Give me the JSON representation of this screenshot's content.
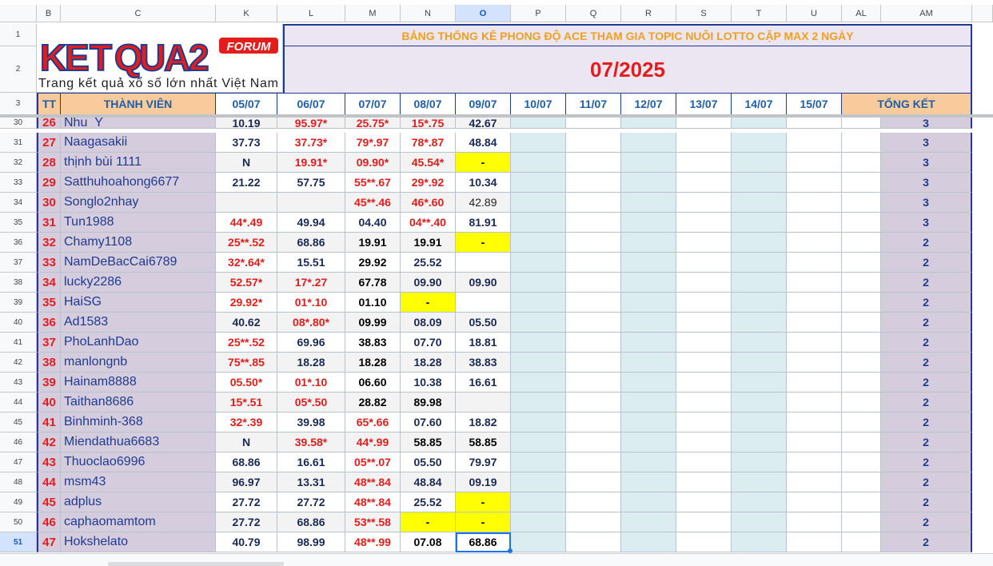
{
  "columns": [
    {
      "id": "B",
      "label": "B"
    },
    {
      "id": "C",
      "label": "C"
    },
    {
      "id": "K",
      "label": "K"
    },
    {
      "id": "L",
      "label": "L"
    },
    {
      "id": "M",
      "label": "M"
    },
    {
      "id": "N",
      "label": "N"
    },
    {
      "id": "O",
      "label": "O"
    },
    {
      "id": "P",
      "label": "P"
    },
    {
      "id": "Q",
      "label": "Q"
    },
    {
      "id": "R",
      "label": "R"
    },
    {
      "id": "S",
      "label": "S"
    },
    {
      "id": "T",
      "label": "T"
    },
    {
      "id": "U",
      "label": "U"
    },
    {
      "id": "AL",
      "label": "AL"
    },
    {
      "id": "AM",
      "label": "AM"
    }
  ],
  "logo": {
    "brand": "KETQUA2",
    "badge": "FORUM",
    "tagline": "Trang kết quả xổ số lớn nhất Việt Nam"
  },
  "title": "BẢNG THỐNG KÊ PHONG ĐỘ ACE THAM GIA TOPIC NUÔI LOTTO CẶP MAX 2 NGÀY",
  "month": "07/2025",
  "header": {
    "tt": "TT",
    "member": "THÀNH VIÊN",
    "dates": [
      "05/07",
      "06/07",
      "07/07",
      "08/07",
      "09/07",
      "10/07",
      "11/07",
      "12/07",
      "13/07",
      "14/07",
      "15/07"
    ],
    "total": "TỔNG KẾT"
  },
  "top_row_numbers": [
    "1",
    "2",
    "3"
  ],
  "rows": [
    {
      "row": "30",
      "tt": "26",
      "name": "Nhu_Y",
      "vals": [
        "10.19",
        "95.97*",
        "25.75*",
        "15*.75",
        "42.67"
      ],
      "total": "3"
    },
    {
      "row": "31",
      "tt": "27",
      "name": "Naagasakii",
      "vals": [
        "37.73",
        "37.73*",
        "79*.97",
        "78*.87",
        "48.84"
      ],
      "total": "3"
    },
    {
      "row": "32",
      "tt": "28",
      "name": "thịnh bùi 1111",
      "vals": [
        "N",
        "19.91*",
        "09.90*",
        "45.54*",
        "-"
      ],
      "total": "3"
    },
    {
      "row": "33",
      "tt": "29",
      "name": "Satthuhoahong6677",
      "vals": [
        "21.22",
        "57.75",
        "55**.67",
        "29*.92",
        "10.34"
      ],
      "total": "3"
    },
    {
      "row": "34",
      "tt": "30",
      "name": "Songlo2nhay",
      "vals": [
        "",
        "",
        "45**.46",
        "46*.60",
        "42.89"
      ],
      "total": "3"
    },
    {
      "row": "35",
      "tt": "31",
      "name": "Tun1988",
      "vals": [
        "44*.49",
        "49.94",
        "04.40",
        "04**.40",
        "81.91"
      ],
      "total": "3"
    },
    {
      "row": "36",
      "tt": "32",
      "name": "Chamy1108",
      "vals": [
        "25**.52",
        "68.86",
        "19.91",
        "19.91",
        "-"
      ],
      "total": "2"
    },
    {
      "row": "37",
      "tt": "33",
      "name": "NamDeBacCai6789",
      "vals": [
        "32*.64*",
        "15.51",
        "29.92",
        "25.52",
        ""
      ],
      "total": "2"
    },
    {
      "row": "38",
      "tt": "34",
      "name": "lucky2286",
      "vals": [
        "52.57*",
        "17*.27",
        "67.78",
        "09.90",
        "09.90"
      ],
      "total": "2"
    },
    {
      "row": "39",
      "tt": "35",
      "name": "HaiSG",
      "vals": [
        "29.92*",
        "01*.10",
        "01.10",
        "-",
        ""
      ],
      "total": "2"
    },
    {
      "row": "40",
      "tt": "36",
      "name": "Ad1583",
      "vals": [
        "40.62",
        "08*.80*",
        "09.99",
        "08.09",
        "05.50"
      ],
      "total": "2"
    },
    {
      "row": "41",
      "tt": "37",
      "name": "PhoLanhDao",
      "vals": [
        "25**.52",
        "69.96",
        "38.83",
        "07.70",
        "18.81"
      ],
      "total": "2"
    },
    {
      "row": "42",
      "tt": "38",
      "name": "manlongnb",
      "vals": [
        "75**.85",
        "18.28",
        "18.28",
        "18.28",
        "38.83"
      ],
      "total": "2"
    },
    {
      "row": "43",
      "tt": "39",
      "name": "Hainam8888",
      "vals": [
        "05.50*",
        "01*.10",
        "06.60",
        "10.38",
        "16.61"
      ],
      "total": "2"
    },
    {
      "row": "44",
      "tt": "40",
      "name": "Taithan8686",
      "vals": [
        "15*.51",
        "05*.50",
        "28.82",
        "89.98",
        ""
      ],
      "total": "2"
    },
    {
      "row": "45",
      "tt": "41",
      "name": "Binhminh-368",
      "vals": [
        "32*.39",
        "39.98",
        "65*.66",
        "07.60",
        "18.82"
      ],
      "total": "2"
    },
    {
      "row": "46",
      "tt": "42",
      "name": "Miendathua6683",
      "vals": [
        "N",
        "39.58*",
        "44*.99",
        "58.85",
        "58.85"
      ],
      "total": "2"
    },
    {
      "row": "47",
      "tt": "43",
      "name": "Thuoclao6996",
      "vals": [
        "68.86",
        "16.61",
        "05**.07",
        "05.50",
        "79.97"
      ],
      "total": "2"
    },
    {
      "row": "48",
      "tt": "44",
      "name": "msm43",
      "vals": [
        "96.97",
        "13.31",
        "48**.84",
        "48.84",
        "09.19"
      ],
      "total": "2"
    },
    {
      "row": "49",
      "tt": "45",
      "name": "adplus",
      "vals": [
        "27.72",
        "27.72",
        "48**.84",
        "25.52",
        "-"
      ],
      "total": "2"
    },
    {
      "row": "50",
      "tt": "46",
      "name": "caphaomamtom",
      "vals": [
        "27.72",
        "68.86",
        "53**.58",
        "-",
        "-"
      ],
      "total": "2"
    },
    {
      "row": "51",
      "tt": "47",
      "name": "Hokshelato",
      "vals": [
        "40.79",
        "98.99",
        "48**.99",
        "07.08",
        "68.86"
      ],
      "total": "2"
    }
  ],
  "styles": {
    "red_cells": [
      [
        0,
        1
      ],
      [
        0,
        2
      ],
      [
        0,
        3
      ],
      [
        1,
        1
      ],
      [
        1,
        2
      ],
      [
        1,
        3
      ],
      [
        2,
        1
      ],
      [
        2,
        2
      ],
      [
        2,
        3
      ],
      [
        3,
        2
      ],
      [
        3,
        3
      ],
      [
        4,
        2
      ],
      [
        4,
        3
      ],
      [
        5,
        0
      ],
      [
        5,
        3
      ],
      [
        6,
        0
      ],
      [
        7,
        0
      ],
      [
        8,
        0
      ],
      [
        8,
        1
      ],
      [
        9,
        0
      ],
      [
        9,
        1
      ],
      [
        10,
        1
      ],
      [
        11,
        0
      ],
      [
        12,
        0
      ],
      [
        13,
        0
      ],
      [
        13,
        1
      ],
      [
        14,
        0
      ],
      [
        14,
        1
      ],
      [
        15,
        0
      ],
      [
        15,
        2
      ],
      [
        16,
        1
      ],
      [
        16,
        2
      ],
      [
        17,
        2
      ],
      [
        18,
        2
      ],
      [
        19,
        2
      ],
      [
        20,
        2
      ],
      [
        21,
        2
      ]
    ],
    "yellow_cells": [
      [
        2,
        4
      ],
      [
        6,
        4
      ],
      [
        9,
        3
      ],
      [
        19,
        4
      ],
      [
        20,
        3
      ],
      [
        20,
        4
      ]
    ],
    "black_cells": [
      [
        6,
        2
      ],
      [
        6,
        3
      ],
      [
        7,
        2
      ],
      [
        8,
        2
      ],
      [
        9,
        2
      ],
      [
        10,
        2
      ],
      [
        11,
        2
      ],
      [
        12,
        2
      ],
      [
        13,
        2
      ],
      [
        14,
        2
      ],
      [
        14,
        3
      ],
      [
        16,
        3
      ],
      [
        16,
        4
      ],
      [
        21,
        3
      ],
      [
        21,
        4
      ]
    ],
    "normal_cells": [
      [
        4,
        4
      ]
    ],
    "colors": {
      "red": "#e31c1c",
      "navy": "#1a2a55",
      "lavender": "#d5ccde",
      "yellow": "#ffff00",
      "orange": "#f9cb9c",
      "light_blue": "#dcedf2"
    }
  }
}
